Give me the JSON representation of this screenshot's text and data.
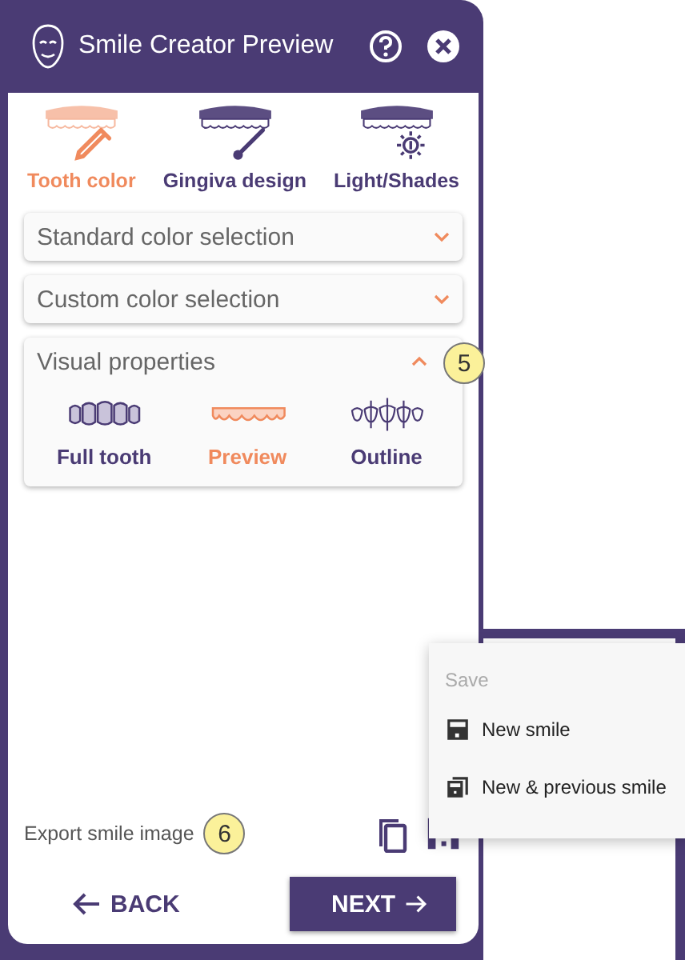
{
  "window": {
    "title": "Smile Creator Preview"
  },
  "tabs": [
    {
      "label": "Tooth color",
      "selected": true,
      "kind": "dropper"
    },
    {
      "label": "Gingiva design",
      "selected": false,
      "kind": "brush"
    },
    {
      "label": "Light/Shades",
      "selected": false,
      "kind": "light"
    }
  ],
  "sections": [
    {
      "title": "Standard color selection",
      "expanded": false
    },
    {
      "title": "Custom color selection",
      "expanded": false
    },
    {
      "title": "Visual properties",
      "expanded": true,
      "badge": "5",
      "options": [
        {
          "label": "Full tooth",
          "selected": false,
          "kind": "full"
        },
        {
          "label": "Preview",
          "selected": true,
          "kind": "preview"
        },
        {
          "label": "Outline",
          "selected": false,
          "kind": "outline"
        }
      ]
    }
  ],
  "export": {
    "label": "Export smile image",
    "badge": "6"
  },
  "buttons": {
    "back": "BACK",
    "next": "NEXT"
  },
  "save_menu": {
    "heading": "Save",
    "items": [
      {
        "label": "New smile",
        "kind": "single"
      },
      {
        "label": "New & previous smile",
        "kind": "double"
      }
    ]
  }
}
